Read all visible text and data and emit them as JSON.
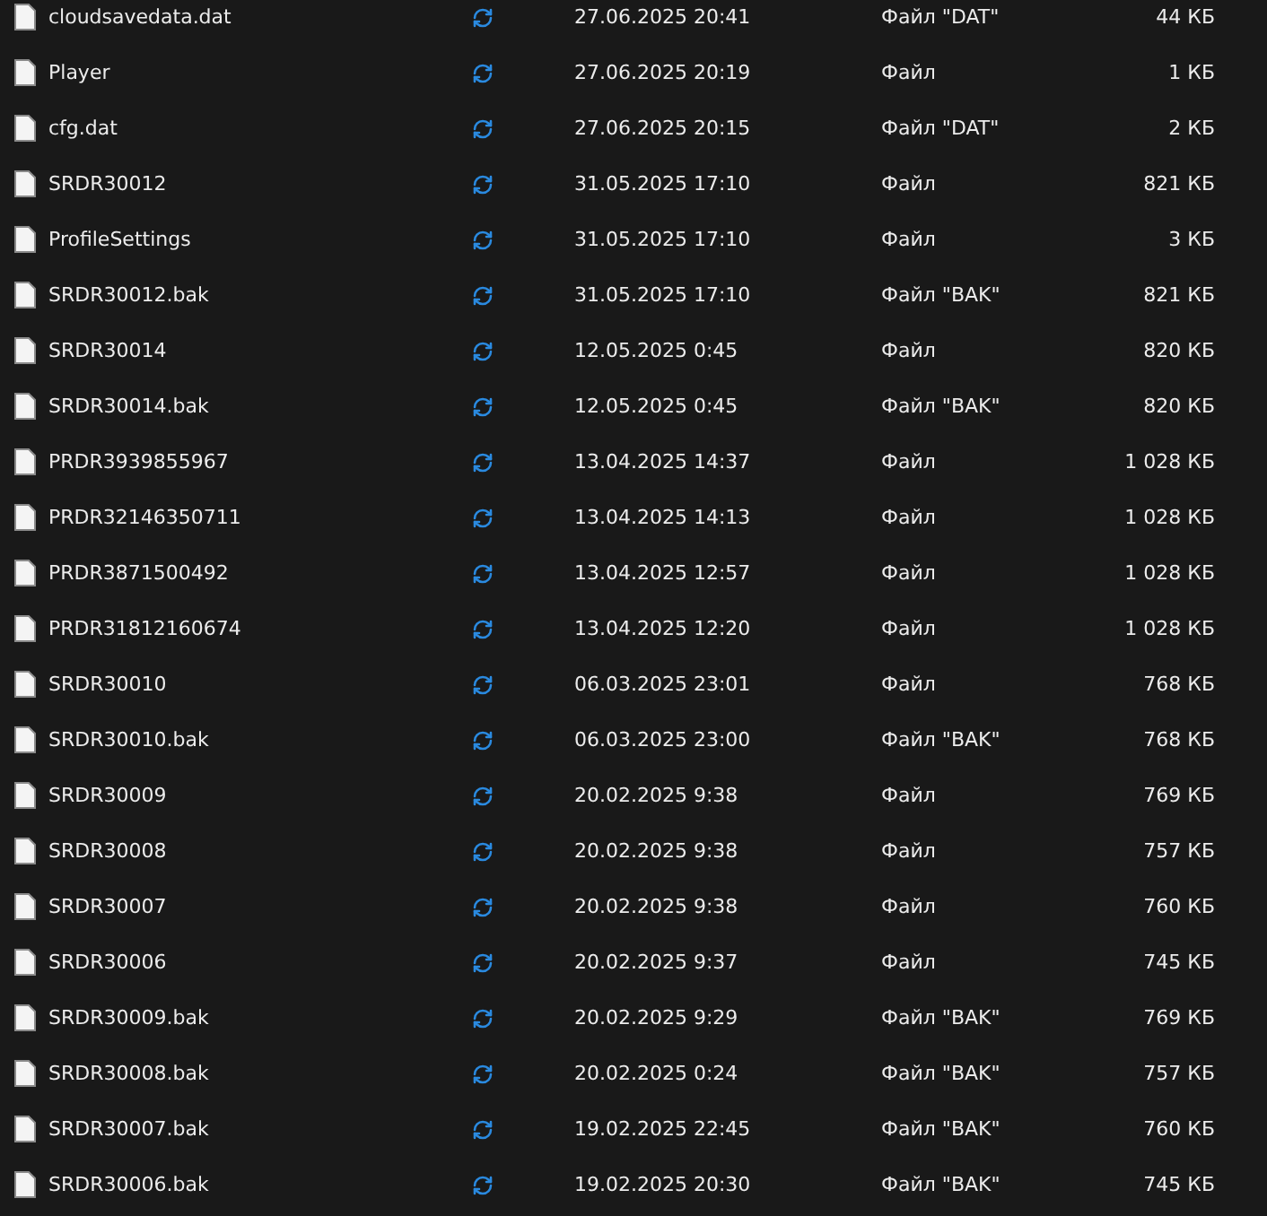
{
  "files": [
    {
      "name": "cloudsavedata.dat",
      "syncing": true,
      "modified": "27.06.2025 20:41",
      "type": "Файл \"DAT\"",
      "size": "44 КБ"
    },
    {
      "name": "Player",
      "syncing": true,
      "modified": "27.06.2025 20:19",
      "type": "Файл",
      "size": "1 КБ"
    },
    {
      "name": "cfg.dat",
      "syncing": true,
      "modified": "27.06.2025 20:15",
      "type": "Файл \"DAT\"",
      "size": "2 КБ"
    },
    {
      "name": "SRDR30012",
      "syncing": true,
      "modified": "31.05.2025 17:10",
      "type": "Файл",
      "size": "821 КБ"
    },
    {
      "name": "ProfileSettings",
      "syncing": true,
      "modified": "31.05.2025 17:10",
      "type": "Файл",
      "size": "3 КБ"
    },
    {
      "name": "SRDR30012.bak",
      "syncing": true,
      "modified": "31.05.2025 17:10",
      "type": "Файл \"BAK\"",
      "size": "821 КБ"
    },
    {
      "name": "SRDR30014",
      "syncing": true,
      "modified": "12.05.2025 0:45",
      "type": "Файл",
      "size": "820 КБ"
    },
    {
      "name": "SRDR30014.bak",
      "syncing": true,
      "modified": "12.05.2025 0:45",
      "type": "Файл \"BAK\"",
      "size": "820 КБ"
    },
    {
      "name": "PRDR3939855967",
      "syncing": true,
      "modified": "13.04.2025 14:37",
      "type": "Файл",
      "size": "1 028 КБ"
    },
    {
      "name": "PRDR32146350711",
      "syncing": true,
      "modified": "13.04.2025 14:13",
      "type": "Файл",
      "size": "1 028 КБ"
    },
    {
      "name": "PRDR3871500492",
      "syncing": true,
      "modified": "13.04.2025 12:57",
      "type": "Файл",
      "size": "1 028 КБ"
    },
    {
      "name": "PRDR31812160674",
      "syncing": true,
      "modified": "13.04.2025 12:20",
      "type": "Файл",
      "size": "1 028 КБ"
    },
    {
      "name": "SRDR30010",
      "syncing": true,
      "modified": "06.03.2025 23:01",
      "type": "Файл",
      "size": "768 КБ"
    },
    {
      "name": "SRDR30010.bak",
      "syncing": true,
      "modified": "06.03.2025 23:00",
      "type": "Файл \"BAK\"",
      "size": "768 КБ"
    },
    {
      "name": "SRDR30009",
      "syncing": true,
      "modified": "20.02.2025 9:38",
      "type": "Файл",
      "size": "769 КБ"
    },
    {
      "name": "SRDR30008",
      "syncing": true,
      "modified": "20.02.2025 9:38",
      "type": "Файл",
      "size": "757 КБ"
    },
    {
      "name": "SRDR30007",
      "syncing": true,
      "modified": "20.02.2025 9:38",
      "type": "Файл",
      "size": "760 КБ"
    },
    {
      "name": "SRDR30006",
      "syncing": true,
      "modified": "20.02.2025 9:37",
      "type": "Файл",
      "size": "745 КБ"
    },
    {
      "name": "SRDR30009.bak",
      "syncing": true,
      "modified": "20.02.2025 9:29",
      "type": "Файл \"BAK\"",
      "size": "769 КБ"
    },
    {
      "name": "SRDR30008.bak",
      "syncing": true,
      "modified": "20.02.2025 0:24",
      "type": "Файл \"BAK\"",
      "size": "757 КБ"
    },
    {
      "name": "SRDR30007.bak",
      "syncing": true,
      "modified": "19.02.2025 22:45",
      "type": "Файл \"BAK\"",
      "size": "760 КБ"
    },
    {
      "name": "SRDR30006.bak",
      "syncing": true,
      "modified": "19.02.2025 20:30",
      "type": "Файл \"BAK\"",
      "size": "745 КБ"
    }
  ]
}
